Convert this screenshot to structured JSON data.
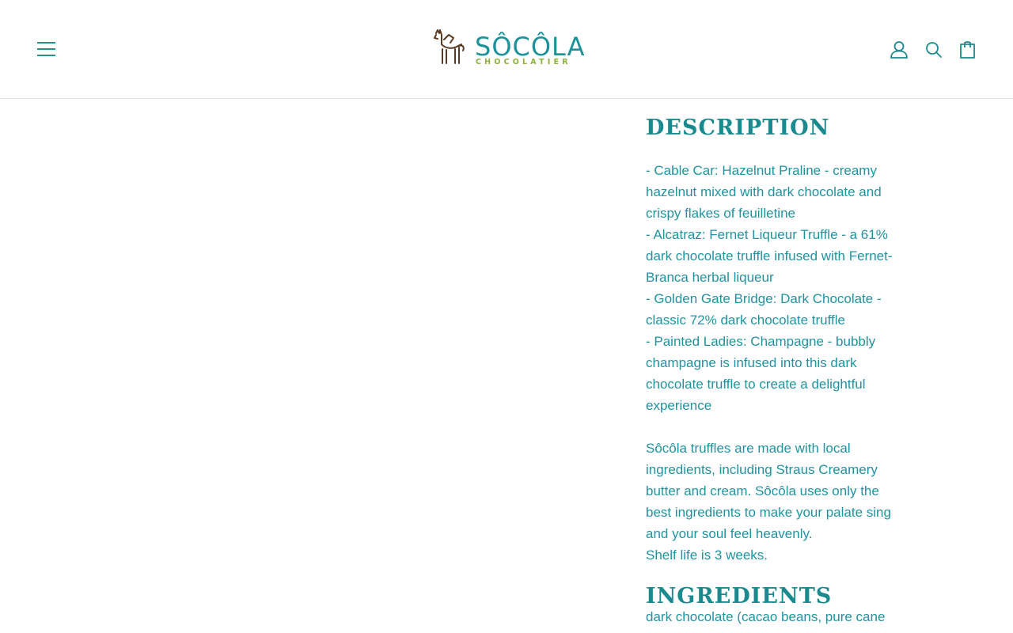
{
  "header": {
    "logo_name": "SÔCÔLA",
    "logo_tagline": "CHOCOLATIER",
    "icons": {
      "menu": "hamburger-menu-icon",
      "account": "user-icon",
      "search": "search-icon",
      "cart": "shopping-bag-icon"
    }
  },
  "description": {
    "heading": "DESCRIPTION",
    "lines": [
      "- Cable Car: Hazelnut Praline - creamy",
      "hazelnut mixed with dark chocolate and",
      "crispy flakes of feuilletine",
      "- Alcatraz: Fernet Liqueur Truffle - a 61%",
      "dark chocolate truffle infused with  Fernet-",
      "Branca herbal liqueur",
      "- Golden Gate Bridge: Dark Chocolate -",
      "classic 72% dark chocolate truffle",
      "- Painted Ladies: Champagne - bubbly",
      "champagne is infused into this dark",
      "chocolate truffle to create a delightful",
      "experience",
      "",
      "Sôcôla truffles are made with local",
      "ingredients, including Straus Creamery",
      "butter and cream. Sôcôla uses only the",
      "best ingredients to make your palate sing",
      "and your soul feel heavenly.",
      "Shelf life is 3 weeks."
    ]
  },
  "ingredients": {
    "heading": "INGREDIENTS",
    "lines": [
      "dark chocolate (cacao beans, pure cane"
    ]
  },
  "colors": {
    "primary": "#1a8a8f",
    "text": "#1f93a0",
    "logo_green": "#8ab23c",
    "logo_brown": "#5a3a22",
    "logo_pink": "#e98b8b"
  }
}
